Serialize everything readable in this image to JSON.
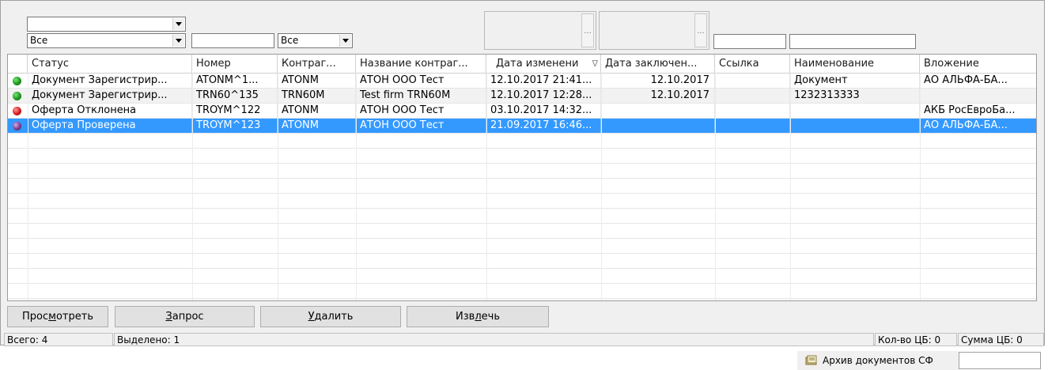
{
  "filters": {
    "status_combo_top": "",
    "status_combo": "Все",
    "number_input": "",
    "counterparty_combo": "Все",
    "name_input": "",
    "title_input": ""
  },
  "columns": [
    "Статус",
    "Номер",
    "Контраг...",
    "Название контраг...",
    "Дата изменени",
    "Дата заключен...",
    "Ссылка",
    "Наименование",
    "Вложение"
  ],
  "rows": [
    {
      "dot_color": "#1a9a1a",
      "status": "Документ Зарегистрир...",
      "number": "ATONM^1...",
      "cp": "ATONM",
      "cp_name": "АТОН ООО Тест",
      "changed": "12.10.2017 21:41...",
      "concluded": "12.10.2017",
      "link": "",
      "name": "Документ",
      "attach": "АО АЛЬФА-БА..."
    },
    {
      "dot_color": "#1a9a1a",
      "status": "Документ Зарегистрир...",
      "number": "TRN60^135",
      "cp": "TRN60M",
      "cp_name": "Test firm TRN60M",
      "changed": "12.10.2017 12:28...",
      "concluded": "12.10.2017",
      "link": "",
      "name": "1232313333",
      "attach": ""
    },
    {
      "dot_color": "#d81a1a",
      "status": "Оферта Отклонена",
      "number": "TROYM^122",
      "cp": "ATONM",
      "cp_name": "АТОН ООО Тест",
      "changed": "03.10.2017 14:32...",
      "concluded": "",
      "link": "",
      "name": "",
      "attach": "АКБ РосЕвроБа..."
    },
    {
      "dot_color": "#7a3f8f",
      "status": "Оферта Проверена",
      "number": "TROYM^123",
      "cp": "ATONM",
      "cp_name": "АТОН ООО Тест",
      "changed": "21.09.2017 16:46...",
      "concluded": "",
      "link": "",
      "name": "",
      "attach": "АО АЛЬФА-БА..."
    }
  ],
  "buttons": {
    "view_pre": "Прос",
    "view_u": "м",
    "view_post": "отреть",
    "request_pre": "",
    "request_u": "З",
    "request_post": "апрос",
    "delete_pre": "",
    "delete_u": "У",
    "delete_post": "далить",
    "extract_pre": "Изв",
    "extract_u": "л",
    "extract_post": "ечь"
  },
  "status": {
    "total": "Всего: 4",
    "selected": "Выделено: 1",
    "cb_count": "Кол-во ЦБ: 0",
    "cb_sum": "Сумма ЦБ: 0"
  },
  "archive": {
    "label": "Архив документов СФ",
    "input": ""
  },
  "colors": {
    "selection": "#3399ff",
    "ellipsis": "..."
  }
}
